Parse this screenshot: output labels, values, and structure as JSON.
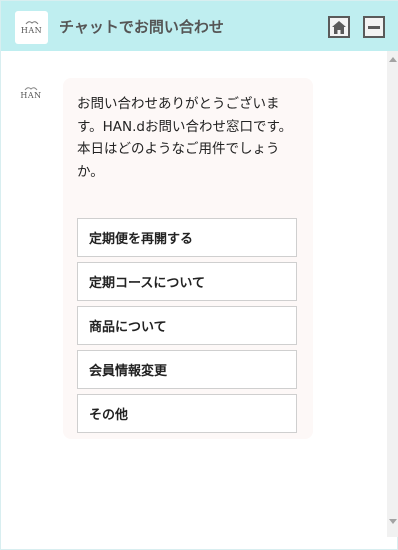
{
  "header": {
    "logo_text": "HAN",
    "title": "チャットでお問い合わせ",
    "home_icon": "home-icon",
    "minimize_icon": "minimize-icon"
  },
  "bot": {
    "avatar_text": "HAN",
    "message_line1": "お問い合わせありがとうございます。HAN.dお問い合わせ窓口です。",
    "message_line2": "本日はどのようなご用件でしょうか。"
  },
  "options": [
    {
      "label": "定期便を再開する"
    },
    {
      "label": "定期コースについて"
    },
    {
      "label": "商品について"
    },
    {
      "label": "会員情報変更"
    },
    {
      "label": "その他"
    }
  ],
  "colors": {
    "header_bg": "#bfeef0",
    "bubble_bg": "#fdf8f7",
    "text": "#222222"
  }
}
